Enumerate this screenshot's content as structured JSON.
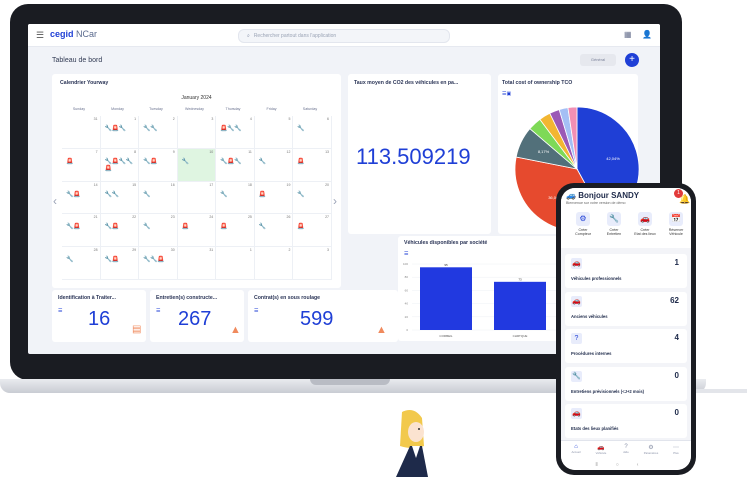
{
  "app": {
    "logo_brand": "cegid",
    "logo_product": " NCar",
    "search_placeholder": "Rechercher partout dans l'application",
    "page_title": "Tableau de bord",
    "filter_pill": "Général",
    "plus_label": "+"
  },
  "calendar": {
    "title": "Calendrier Yourway",
    "month": "January 2024",
    "days": [
      "Sunday",
      "Monday",
      "Tuesday",
      "Wednesday",
      "Thursday",
      "Friday",
      "Saturday"
    ],
    "weeks": [
      [
        {
          "n": "31",
          "e": ""
        },
        {
          "n": "1",
          "e": "🔧🚨🔧"
        },
        {
          "n": "2",
          "e": "🔧🔧"
        },
        {
          "n": "3",
          "e": ""
        },
        {
          "n": "4",
          "e": "🚨🔧🔧"
        },
        {
          "n": "5",
          "e": ""
        },
        {
          "n": "6",
          "e": "🔧"
        }
      ],
      [
        {
          "n": "7",
          "e": "🚨"
        },
        {
          "n": "8",
          "e": "🔧🚨🔧🔧🚨"
        },
        {
          "n": "9",
          "e": "🔧🚨"
        },
        {
          "n": "10",
          "e": "🔧"
        },
        {
          "n": "11",
          "e": "🔧🚨🔧"
        },
        {
          "n": "12",
          "e": "🔧"
        },
        {
          "n": "13",
          "e": "🚨"
        }
      ],
      [
        {
          "n": "14",
          "e": "🔧🚨"
        },
        {
          "n": "15",
          "e": "🔧🔧"
        },
        {
          "n": "16",
          "e": "🔧"
        },
        {
          "n": "17",
          "e": ""
        },
        {
          "n": "18",
          "e": "🔧"
        },
        {
          "n": "19",
          "e": "🚨"
        },
        {
          "n": "20",
          "e": "🔧"
        }
      ],
      [
        {
          "n": "21",
          "e": "🔧🚨"
        },
        {
          "n": "22",
          "e": "🔧🚨"
        },
        {
          "n": "23",
          "e": "🔧"
        },
        {
          "n": "24",
          "e": "🚨"
        },
        {
          "n": "25",
          "e": "🚨"
        },
        {
          "n": "26",
          "e": "🔧"
        },
        {
          "n": "27",
          "e": "🚨"
        }
      ],
      [
        {
          "n": "28",
          "e": "🔧"
        },
        {
          "n": "29",
          "e": "🔧🚨"
        },
        {
          "n": "30",
          "e": "🔧🔧🚨"
        },
        {
          "n": "31",
          "e": ""
        },
        {
          "n": "1",
          "e": ""
        },
        {
          "n": "2",
          "e": ""
        },
        {
          "n": "3",
          "e": ""
        }
      ]
    ]
  },
  "co2": {
    "title": "Taux moyen de CO2 des véhicules en pa...",
    "value": "113.509219"
  },
  "tco": {
    "title": "Total cost of ownership TCO",
    "slices": [
      {
        "label": "42,04%",
        "value": 42.04,
        "color": "#1f3fd6"
      },
      {
        "label": "36,06%",
        "value": 36.06,
        "color": "#e64a2e"
      },
      {
        "label": "8,17%",
        "value": 8.17,
        "color": "#52707a"
      },
      {
        "label": "",
        "value": 3.5,
        "color": "#7ed957"
      },
      {
        "label": "",
        "value": 3.0,
        "color": "#f2b632"
      },
      {
        "label": "",
        "value": 2.6,
        "color": "#9b59b6"
      },
      {
        "label": "",
        "value": 2.3,
        "color": "#a4bff5"
      },
      {
        "label": "",
        "value": 2.33,
        "color": "#f28fb4"
      }
    ]
  },
  "vehicles_available": {
    "title": "Véhicules disponibles par société",
    "chart_data": {
      "type": "bar",
      "categories": [
        "CORBEIL",
        "CHRTQUE"
      ],
      "values": [
        95,
        73
      ],
      "data_labels": [
        "95",
        "73"
      ],
      "ylim": [
        0,
        100
      ],
      "yticks": [
        "100",
        "80",
        "60",
        "40",
        "20",
        "0"
      ]
    }
  },
  "kpis": [
    {
      "title": "Identification à Traiter...",
      "value": "16"
    },
    {
      "title": "Entretien(s) constructe...",
      "value": "267"
    },
    {
      "title": "Contrat(s) en sous roulage",
      "value": "599"
    }
  ],
  "phone": {
    "greeting": "Bonjour SANDY",
    "subtitle": "Bienvenue sur votre version de démo",
    "badge": "1",
    "actions": [
      {
        "l1": "Créer",
        "l2": "Compteur"
      },
      {
        "l1": "Créer",
        "l2": "Entretien"
      },
      {
        "l1": "Créer",
        "l2": "Etat des lieux"
      },
      {
        "l1": "Réserver",
        "l2": "Véhicule"
      }
    ],
    "stats": [
      {
        "label": "Véhicules professionnels",
        "value": "1"
      },
      {
        "label": "Anciens véhicules",
        "value": "62"
      },
      {
        "label": "Procédures internes",
        "value": "4"
      },
      {
        "label": "Entretiens prévisionnels (<J+2 mois)",
        "value": "0"
      },
      {
        "label": "Etats des lieux planifiés",
        "value": "0"
      }
    ],
    "nav": [
      "Accueil",
      "Véhicule",
      "Aide",
      "Paramètres",
      "Plus"
    ]
  }
}
